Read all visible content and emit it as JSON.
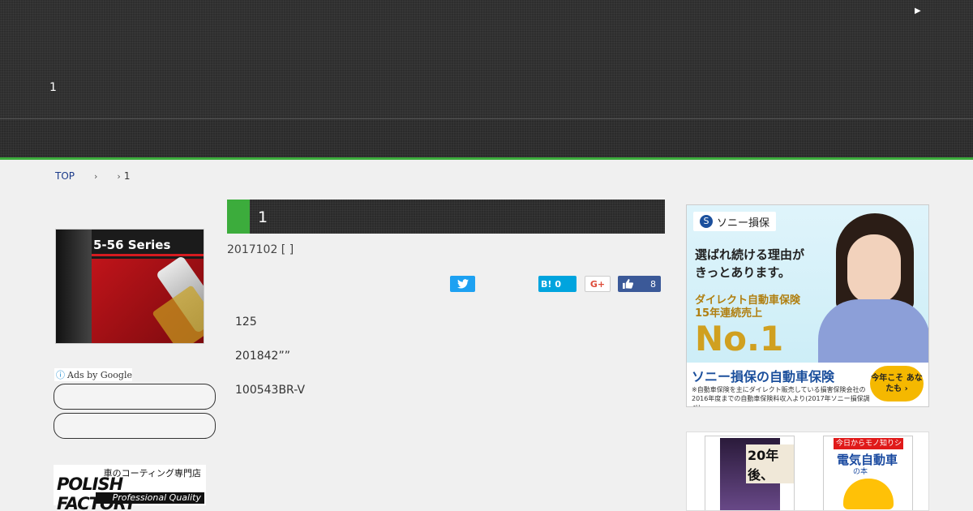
{
  "header": {
    "play_icon": "▶",
    "site_title": "1"
  },
  "colors": {
    "accent_green": "#3cac3c",
    "header_bg": "#2e2e2e",
    "twitter": "#1da1f2",
    "hatena": "#00a4de",
    "facebook": "#3b5998"
  },
  "breadcrumb": {
    "top": "TOP",
    "sep1": "›",
    "sep2": "›",
    "current": "1"
  },
  "sidebar": {
    "banner_title": "5-56 Series",
    "ads_by": "Ads by Google",
    "ads_info_icon": "ⓘ",
    "polish_small": "車のコーティング専門店",
    "polish_main": "POLISH FACTORY",
    "polish_sub": "Professional Quality"
  },
  "article": {
    "title": "1",
    "date": "2017102 [    ]",
    "paragraphs": [
      "125",
      "201842””",
      "100543BR-V"
    ]
  },
  "share": {
    "twitter_icon": "twitter-bird",
    "hatena_label": "B!",
    "hatena_count": "0",
    "gplus_label": "G+",
    "fb_count": "8"
  },
  "sony_ad": {
    "logo": "ソニー損保",
    "logo_mark": "S",
    "line1": "選ばれ続ける理由が",
    "line2": "きっとあります。",
    "line3": "ダイレクト自動車保険",
    "line4": "15年連続売上",
    "no1": "No.1",
    "bottom_title": "ソニー損保の自動車保険",
    "note": "※自動車保険を主にダイレクト販売している損害保険会社の2016年度までの自動車保険料収入より(2017年ソニー損保調べ)。",
    "badge": "今年こそ あなたも ›"
  },
  "books": {
    "book1_title": "20年後、",
    "book2_band": "今日からモノ知りシリーズ",
    "book2_title": "電気自動車",
    "book2_sub": "の本"
  }
}
